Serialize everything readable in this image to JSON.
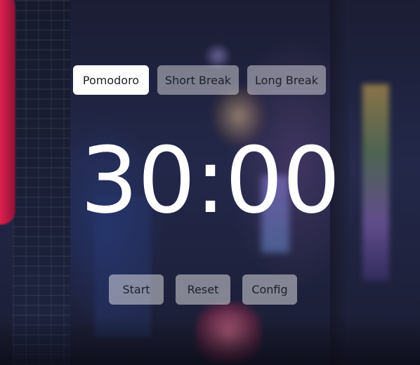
{
  "modes": [
    {
      "label": "Pomodoro",
      "active": true
    },
    {
      "label": "Short Break",
      "active": false
    },
    {
      "label": "Long Break",
      "active": false
    }
  ],
  "timer": {
    "display": "30:00"
  },
  "controls": {
    "start_label": "Start",
    "reset_label": "Reset",
    "config_label": "Config"
  },
  "colors": {
    "active_button_bg": "#ffffff",
    "inactive_button_bg": "rgba(255,255,255,0.42)",
    "timer_text": "#ffffff",
    "button_text": "#1e1f26"
  }
}
